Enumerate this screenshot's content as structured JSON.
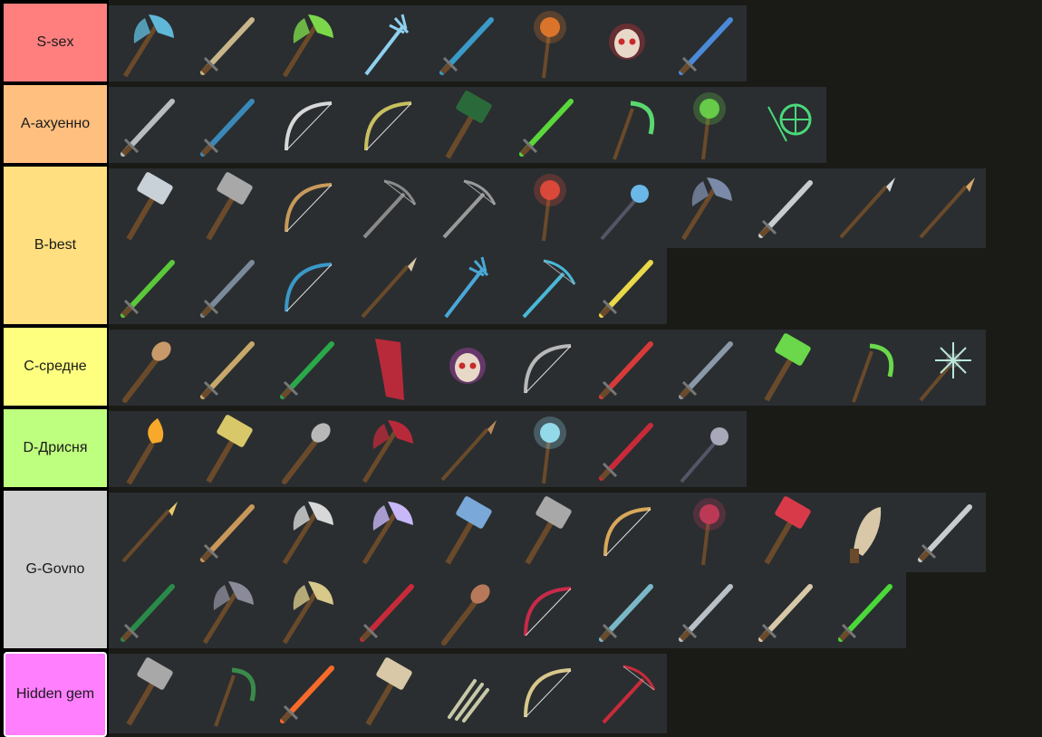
{
  "tiers": [
    {
      "id": "S",
      "label": "S-sex",
      "color": "#ff7f7f",
      "rows": 1,
      "items": [
        {
          "icon": "double-axe-icon",
          "type": "axe",
          "accent": "#5fb8d8"
        },
        {
          "icon": "long-sword-icon",
          "type": "sword",
          "accent": "#c8b68a"
        },
        {
          "icon": "double-axe-icon",
          "type": "axe",
          "accent": "#7cd84a"
        },
        {
          "icon": "trident-icon",
          "type": "trident",
          "accent": "#8fd0f0"
        },
        {
          "icon": "blade-sword-icon",
          "type": "sword",
          "accent": "#3a9ac8"
        },
        {
          "icon": "fire-staff-icon",
          "type": "staff",
          "accent": "#e87a2a"
        },
        {
          "icon": "skull-staff-icon",
          "type": "skull",
          "accent": "#d8303a"
        },
        {
          "icon": "ice-sword-icon",
          "type": "sword",
          "accent": "#4a8ad8"
        }
      ]
    },
    {
      "id": "A",
      "label": "A-ахуенно",
      "color": "#ffbf7f",
      "rows": 1,
      "items": [
        {
          "icon": "long-sword-icon",
          "type": "sword",
          "accent": "#b8bcc0"
        },
        {
          "icon": "blade-sword-icon",
          "type": "sword",
          "accent": "#3a88b8"
        },
        {
          "icon": "bow-icon",
          "type": "bow",
          "accent": "#d8d8d8"
        },
        {
          "icon": "crossbow-icon",
          "type": "bow",
          "accent": "#c8c060"
        },
        {
          "icon": "hammer-icon",
          "type": "hammer",
          "accent": "#2a6a3a"
        },
        {
          "icon": "green-sword-icon",
          "type": "sword",
          "accent": "#5ad83a"
        },
        {
          "icon": "dark-scythe-icon",
          "type": "scythe",
          "accent": "#5ad870"
        },
        {
          "icon": "vine-staff-icon",
          "type": "staff",
          "accent": "#6ad84a"
        },
        {
          "icon": "nature-staff-icon",
          "type": "wheel",
          "accent": "#4ad87a"
        }
      ]
    },
    {
      "id": "B",
      "label": "B-best",
      "color": "#ffdf7f",
      "rows": 2,
      "items": [
        {
          "icon": "war-hammer-icon",
          "type": "hammer",
          "accent": "#c8d0d8"
        },
        {
          "icon": "mace-icon",
          "type": "hammer",
          "accent": "#a8a8a8"
        },
        {
          "icon": "bow-icon",
          "type": "bow",
          "accent": "#c89a5a"
        },
        {
          "icon": "crossbow-icon",
          "type": "crossbow",
          "accent": "#8a8a8a"
        },
        {
          "icon": "crossbow-icon",
          "type": "crossbow",
          "accent": "#9a9a9a"
        },
        {
          "icon": "orb-staff-icon",
          "type": "staff",
          "accent": "#e84a3a"
        },
        {
          "icon": "spiked-mace-icon",
          "type": "mace",
          "accent": "#6ab8e8"
        },
        {
          "icon": "double-axe-icon",
          "type": "axe",
          "accent": "#7a8aa8"
        },
        {
          "icon": "long-sword-icon",
          "type": "sword",
          "accent": "#c8ccd0"
        },
        {
          "icon": "halberd-icon",
          "type": "spear",
          "accent": "#d8d8d8"
        },
        {
          "icon": "halberd-icon",
          "type": "spear",
          "accent": "#d8a86a"
        },
        {
          "icon": "green-sword-icon",
          "type": "sword",
          "accent": "#5ac83a"
        },
        {
          "icon": "dark-sword-icon",
          "type": "sword",
          "accent": "#7a8a9a"
        },
        {
          "icon": "ice-bow-icon",
          "type": "bow",
          "accent": "#3a98c8"
        },
        {
          "icon": "spear-icon",
          "type": "spear",
          "accent": "#d8c8a8"
        },
        {
          "icon": "ice-trident-icon",
          "type": "trident",
          "accent": "#4aa8d8"
        },
        {
          "icon": "ice-crossbow-icon",
          "type": "crossbow",
          "accent": "#4ab8d8"
        },
        {
          "icon": "golden-blade-icon",
          "type": "sword",
          "accent": "#e8d84a"
        }
      ]
    },
    {
      "id": "C",
      "label": "C-средне",
      "color": "#ffff7f",
      "rows": 1,
      "items": [
        {
          "icon": "club-icon",
          "type": "club",
          "accent": "#c89a6a"
        },
        {
          "icon": "dagger-icon",
          "type": "sword",
          "accent": "#c8a86a"
        },
        {
          "icon": "green-blade-icon",
          "type": "sword",
          "accent": "#2aa84a"
        },
        {
          "icon": "cloak-icon",
          "type": "cloak",
          "accent": "#b82a3a"
        },
        {
          "icon": "skull-icon",
          "type": "skull",
          "accent": "#d84ad8"
        },
        {
          "icon": "bow-icon",
          "type": "bow",
          "accent": "#b8b8b8"
        },
        {
          "icon": "red-sword-icon",
          "type": "sword",
          "accent": "#d83a3a"
        },
        {
          "icon": "dark-sword-icon",
          "type": "sword",
          "accent": "#8a98a8"
        },
        {
          "icon": "green-hammer-icon",
          "type": "hammer",
          "accent": "#6ad84a"
        },
        {
          "icon": "vine-scythe-icon",
          "type": "scythe",
          "accent": "#6ad84a"
        },
        {
          "icon": "star-mace-icon",
          "type": "star",
          "accent": "#b8e8d8"
        }
      ]
    },
    {
      "id": "D",
      "label": "D-Дрисня",
      "color": "#bfff7f",
      "rows": 1,
      "items": [
        {
          "icon": "torch-icon",
          "type": "torch",
          "accent": "#f8a82a"
        },
        {
          "icon": "rake-icon",
          "type": "hammer",
          "accent": "#d8c86a"
        },
        {
          "icon": "stone-club-icon",
          "type": "club",
          "accent": "#b8b8b8"
        },
        {
          "icon": "blood-axe-icon",
          "type": "axe",
          "accent": "#b82a3a"
        },
        {
          "icon": "wooden-spear-icon",
          "type": "spear",
          "accent": "#b8885a"
        },
        {
          "icon": "frost-staff-icon",
          "type": "staff",
          "accent": "#9ae8f8"
        },
        {
          "icon": "red-sword-icon",
          "type": "sword",
          "accent": "#c82a3a"
        },
        {
          "icon": "spiked-mace-icon",
          "type": "mace",
          "accent": "#a8a8b8"
        }
      ]
    },
    {
      "id": "G",
      "label": "G-Govno",
      "color": "#cfcfcf",
      "rows": 2,
      "items": [
        {
          "icon": "scythe-icon",
          "type": "spear",
          "accent": "#e8c86a"
        },
        {
          "icon": "dagger-icon",
          "type": "sword",
          "accent": "#c8985a"
        },
        {
          "icon": "axe-icon",
          "type": "axe",
          "accent": "#d8d8d8"
        },
        {
          "icon": "crystal-axe-icon",
          "type": "axe",
          "accent": "#c8b8f8"
        },
        {
          "icon": "war-hammer-icon",
          "type": "hammer",
          "accent": "#7aa8d8"
        },
        {
          "icon": "sledgehammer-icon",
          "type": "hammer",
          "accent": "#a8a8a8"
        },
        {
          "icon": "bow-icon",
          "type": "bow",
          "accent": "#d8a85a"
        },
        {
          "icon": "tentacle-staff-icon",
          "type": "staff",
          "accent": "#c83a5a"
        },
        {
          "icon": "red-hammer-icon",
          "type": "hammer",
          "accent": "#d83a4a"
        },
        {
          "icon": "knife-icon",
          "type": "knife",
          "accent": "#d8c8a8"
        },
        {
          "icon": "short-sword-icon",
          "type": "sword",
          "accent": "#c8ccd0"
        },
        {
          "icon": "green-scimitar-icon",
          "type": "sword",
          "accent": "#2a8a4a"
        },
        {
          "icon": "pickaxe-icon",
          "type": "axe",
          "accent": "#8a8a98"
        },
        {
          "icon": "axe-icon",
          "type": "axe",
          "accent": "#d8c88a"
        },
        {
          "icon": "red-blade-icon",
          "type": "sword",
          "accent": "#c82a3a"
        },
        {
          "icon": "club-icon",
          "type": "club",
          "accent": "#b8785a"
        },
        {
          "icon": "red-bow-icon",
          "type": "bow",
          "accent": "#c82a4a"
        },
        {
          "icon": "ice-spear-icon",
          "type": "sword",
          "accent": "#7ab8c8"
        },
        {
          "icon": "long-sword-icon",
          "type": "sword",
          "accent": "#b8c0c8"
        },
        {
          "icon": "gold-sword-icon",
          "type": "sword",
          "accent": "#d8c8a8"
        },
        {
          "icon": "green-sword-icon",
          "type": "sword",
          "accent": "#4ad83a"
        }
      ]
    },
    {
      "id": "H",
      "label": "Hidden gem",
      "color": "#ff7fff",
      "rows": 1,
      "items": [
        {
          "icon": "stone-hammer-icon",
          "type": "hammer",
          "accent": "#a8a8a8"
        },
        {
          "icon": "sickle-icon",
          "type": "scythe",
          "accent": "#3a8a4a"
        },
        {
          "icon": "flame-sword-icon",
          "type": "sword",
          "accent": "#f86a2a"
        },
        {
          "icon": "bone-hammer-icon",
          "type": "hammer",
          "accent": "#d8c8a8"
        },
        {
          "icon": "claw-icon",
          "type": "claw",
          "accent": "#c8c8a8"
        },
        {
          "icon": "bow-icon",
          "type": "bow",
          "accent": "#d8c88a"
        },
        {
          "icon": "red-crossbow-icon",
          "type": "crossbow",
          "accent": "#c82a3a"
        }
      ]
    }
  ]
}
